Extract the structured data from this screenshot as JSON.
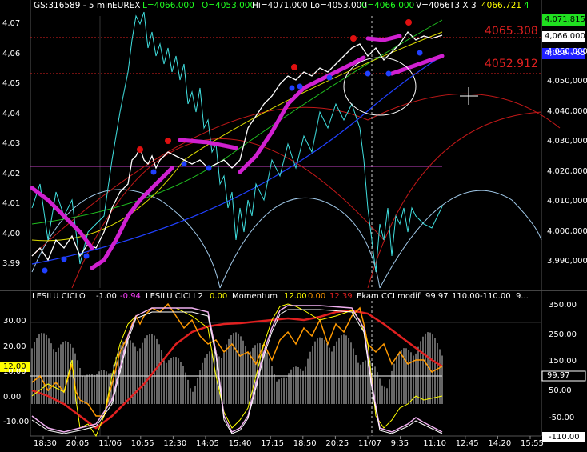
{
  "header": {
    "symbol": "GS:316589 - 5 min",
    "exchange": "EUREX",
    "last": "L=4066.000",
    "open": "O=4053.000",
    "high": "Hi=4071.000",
    "low": "Lo=4053.000",
    "close": "C=4066.000",
    "volume": "V=4066",
    "trades": "T3 X 3",
    "value": "4066.721",
    "num": "4"
  },
  "levels": {
    "upper": "4065.308",
    "lower": "4052.912",
    "badge_green": "4,071.815",
    "badge_white": "4,066.000",
    "badge_blue": "4,059.765"
  },
  "price_axis": [
    "4,070,000",
    "4,060,000",
    "4,050,000",
    "4,040,000",
    "4,030,000",
    "4,020,000",
    "4,010,000",
    "4,000,000",
    "3,990,000"
  ],
  "left_axis": [
    "4,07",
    "4,06",
    "4,05",
    "4,04",
    "4,03",
    "4,02",
    "4,01",
    "4,00",
    "3,99"
  ],
  "subpanel": {
    "ind1_name": "LESILU CICLO",
    "ind1_val": "-1.00",
    "ind2_val": "-0.94",
    "ind2_name": "LESILU CICLI 2",
    "mom_val": "0.00",
    "mom_name": "Momentum",
    "v1": "12.00",
    "v2": "0.00",
    "v3": "12.39",
    "cci_name": "Ekam CCI modif",
    "cci_val": "99.97",
    "lvl_hi": "110.00",
    "lvl_lo": "-110.00",
    "trail": "9..."
  },
  "sub_left_axis": [
    "30.00",
    "20.00",
    "10.00",
    "0.00",
    "-10.00"
  ],
  "sub_left_badge": "12.00",
  "sub_right_axis": [
    "350.00",
    "250.00",
    "150.00",
    "50.00",
    "-50.00"
  ],
  "sub_right_badge": "99.97",
  "sub_right_bottom": "-110.00",
  "time_axis": [
    "18:30",
    "20:05",
    "11/06",
    "10:55",
    "12:30",
    "14:05",
    "15:40",
    "17:15",
    "18:50",
    "20:25",
    "11/07",
    "9:35",
    "11:10",
    "12:45",
    "14:20",
    "15:55"
  ],
  "colors": {
    "price": "#ffffff",
    "cyan": "#40e0e0",
    "magenta": "#d020d0",
    "red": "#e02020",
    "blue": "#2040ff",
    "green": "#20c020",
    "yellow": "#ffff00",
    "orange": "#ff9900",
    "level_red": "#e02020",
    "level_magenta": "#c040c0"
  }
}
